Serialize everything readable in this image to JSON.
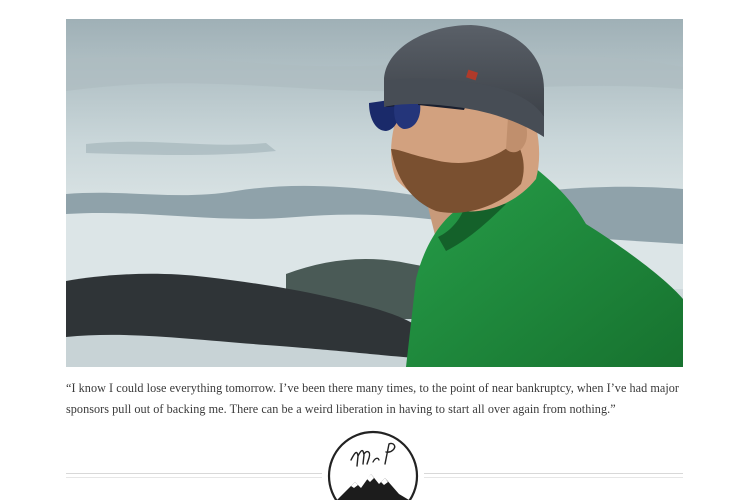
{
  "article": {
    "photo_alt": "photo",
    "quote": "“I know I could lose everything tomorrow. I’ve been there many times, to the point of near bankruptcy, when I’ve had major sponsors pull out of backing me. There can be a weird liberation in having to start all over again from nothing.”"
  },
  "emblem": {
    "signature": "Mr P",
    "icon": "mountain-signature-emblem"
  },
  "colors": {
    "text": "#3a3a3a",
    "jacket": "#1f8a3c",
    "hat": "#4a5058",
    "sky": "#c4d3d8",
    "divider": "#d8d8d8"
  }
}
